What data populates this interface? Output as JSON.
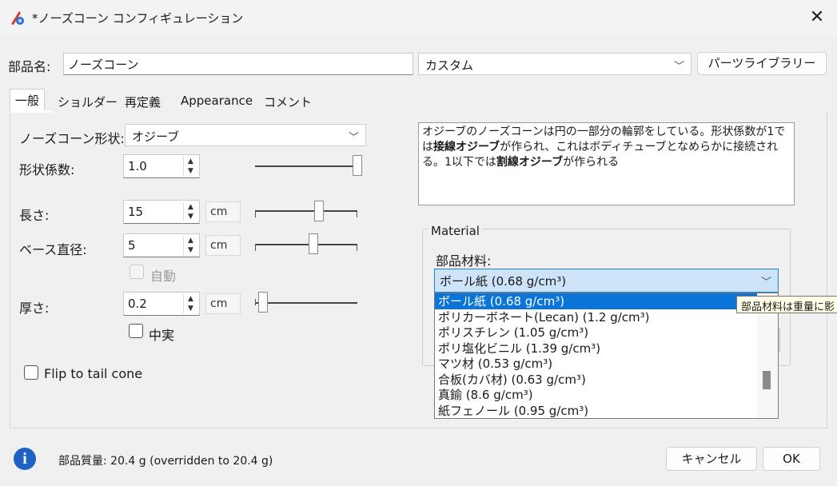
{
  "window": {
    "title": "*ノーズコーン コンフィギュレーション",
    "icon": "rocket-app-icon",
    "close_icon": "close-icon"
  },
  "header": {
    "component_name_label": "部品名:",
    "component_name_value": "ノーズコーン",
    "preset_value": "カスタム",
    "parts_library_button": "パーツライブラリー"
  },
  "tabs": [
    {
      "label": "一般",
      "active": true
    },
    {
      "label": "ショルダー",
      "active": false
    },
    {
      "label": "再定義",
      "active": false
    },
    {
      "label": "Appearance",
      "active": false
    },
    {
      "label": "コメント",
      "active": false
    }
  ],
  "general": {
    "shape_label": "ノーズコーン形状:",
    "shape_value": "オジーブ",
    "shape_param_label": "形状係数:",
    "shape_param_value": "1.0",
    "length_label": "長さ:",
    "length_value": "15",
    "length_unit": "cm",
    "diameter_label": "ベース直径:",
    "diameter_value": "5",
    "diameter_unit": "cm",
    "auto_label": "自動",
    "thickness_label": "厚さ:",
    "thickness_value": "0.2",
    "thickness_unit": "cm",
    "filled_label": "中実",
    "flip_label": "Flip to tail cone"
  },
  "description": {
    "part1": "オジーブのノーズコーンは円の一部分の輪郭をしている。形状係数が1では",
    "bold1": "接線オジーブ",
    "part2": "が作られ、これはボディチューブとなめらかに接続される。1以下では",
    "bold2": "割線オジーブ",
    "part3": "が作られる"
  },
  "material": {
    "group_title": "Material",
    "label": "部品材料:",
    "selected": "ボール紙 (0.68 g/cm³)",
    "options": [
      "ボール紙 (0.68 g/cm³)",
      "ポリカーボネート(Lecan) (1.2 g/cm³)",
      "ポリスチレン (1.05 g/cm³)",
      "ポリ塩化ビニル (1.39 g/cm³)",
      "マツ材 (0.53 g/cm³)",
      "合板(カバ材) (0.63 g/cm³)",
      "真鍮 (8.6 g/cm³)",
      "紙フェノール (0.95 g/cm³)"
    ],
    "tooltip": "部品材料は重量に影"
  },
  "footer": {
    "info_icon": "info-icon",
    "mass_text": "部品質量: 20.4 g (overridden to 20.4 g)",
    "cancel_button": "キャンセル",
    "ok_button": "OK"
  },
  "colors": {
    "selection": "#0a74d8",
    "combo_focus": "#cde3f7",
    "info_blue": "#1d62c4"
  }
}
